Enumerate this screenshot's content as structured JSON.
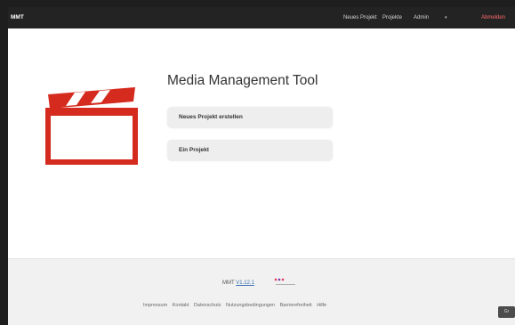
{
  "navbar": {
    "brand": "MMT",
    "links": [
      "Neues Projekt",
      "Projekte",
      "Admin"
    ],
    "logout": "Abmelden"
  },
  "hero": {
    "title": "Media Management Tool",
    "buttons": [
      "Neues Projekt erstellen",
      "Ein Projekt"
    ],
    "logo_icon": "clapperboard-icon",
    "accent_color": "#d42b1e"
  },
  "footer": {
    "version_prefix": "MMT",
    "version": "V1.12.1",
    "links": [
      "Impressum",
      "Kontakt",
      "Datenschutz",
      "Nutzungsbedingungen",
      "Barrierefreiheit",
      "Hilfe"
    ]
  },
  "corner": {
    "label": "Gr"
  }
}
